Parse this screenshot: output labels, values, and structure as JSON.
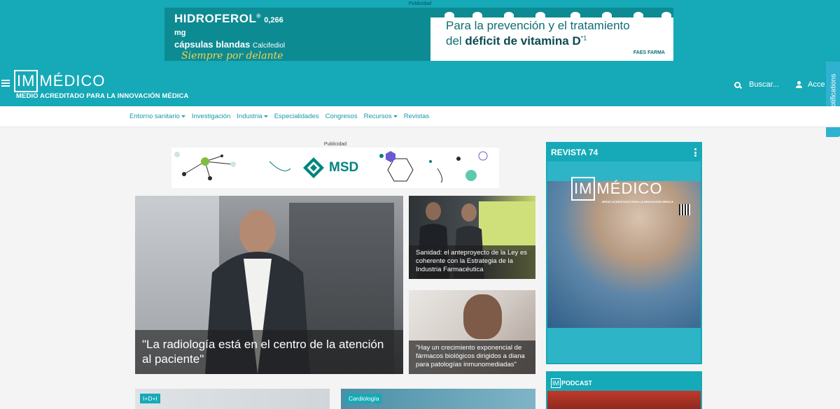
{
  "top_ad": {
    "label": "Publicidad",
    "brand": "HIDROFEROL",
    "reg": "®",
    "dose": "0,266 mg",
    "caps": "cápsulas blandas",
    "active": "Calcifediol",
    "slogan": "Siempre por delante",
    "headline_line1": "Para la prevención y el tratamiento",
    "headline_prefix": "del ",
    "headline_bold": "déficit de vitamina D",
    "headline_sup": "*1",
    "company": "FAES FARMA"
  },
  "header": {
    "logo_box": "IM",
    "logo_rest": "MÉDICO",
    "tagline": "MEDIO ACREDITADO PARA LA INNOVACIÓN MÉDICA",
    "search_label": "Buscar...",
    "access_label": "Acce",
    "notifications_tab": "Get Notifications"
  },
  "nav": {
    "items": [
      {
        "label": "Entorno sanitario"
      },
      {
        "label": "Investigación"
      },
      {
        "label": "Industria"
      },
      {
        "label": "Especialidades"
      },
      {
        "label": "Congresos"
      },
      {
        "label": "Recursos"
      },
      {
        "label": "Revistas"
      }
    ]
  },
  "mid_ad": {
    "label": "Publicidad",
    "brand": "MSD"
  },
  "articles": {
    "main": {
      "title": "\"La radiología está en el centro de la atención al paciente\""
    },
    "side1": {
      "title": "Sanidad: el anteproyecto de la Ley es coherente con la Estrategia de la Industria Farmacéutica"
    },
    "side2": {
      "title": "\"Hay un crecimiento exponencial de fármacos biológicos dirigidos a diana para patologías inmunomediadas\""
    },
    "bottom1": {
      "tag": "I+D+I"
    },
    "bottom2": {
      "tag": "Cardiología"
    }
  },
  "sidebar": {
    "magazine_title": "REVISTA 74",
    "cover_logo_box": "IM",
    "cover_logo_rest": "MÉDICO",
    "cover_tagline": "MEDIO ACREDITADO PARA LA INNOVACIÓN MÉDICA",
    "podcast_logo_box": "IM",
    "podcast_logo_rest": "PODCAST"
  },
  "colors": {
    "brand_teal": "#16a9b7",
    "nav_link": "#159aa8",
    "msd_green": "#00857c"
  }
}
